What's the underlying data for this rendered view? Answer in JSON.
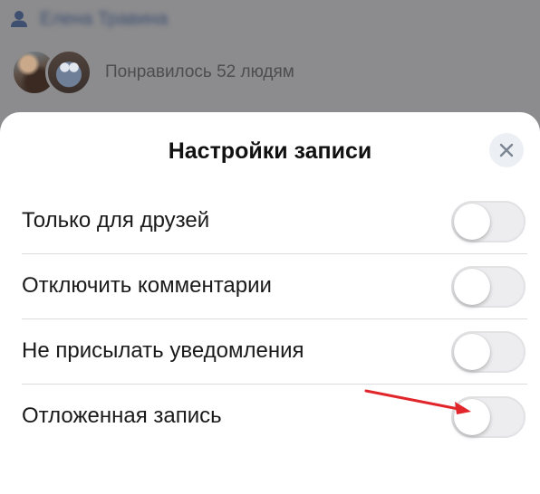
{
  "post": {
    "author_name": "Елена Травина",
    "likes_text": "Понравилось 52 людям",
    "icons": [
      "person-icon"
    ]
  },
  "sheet": {
    "title": "Настройки записи",
    "close_icon": "close-icon",
    "settings": [
      {
        "label": "Только для друзей",
        "enabled": false
      },
      {
        "label": "Отключить комментарии",
        "enabled": false
      },
      {
        "label": "Не присылать уведомления",
        "enabled": false
      },
      {
        "label": "Отложенная запись",
        "enabled": false
      }
    ]
  },
  "annotation": {
    "type": "arrow",
    "target": "Отложенная запись",
    "color": "#e0262b"
  },
  "colors": {
    "backdrop": "#8c8c8e",
    "sheet_bg": "#ffffff",
    "toggle_off": "#ededef",
    "close_bg": "#eceff3"
  }
}
